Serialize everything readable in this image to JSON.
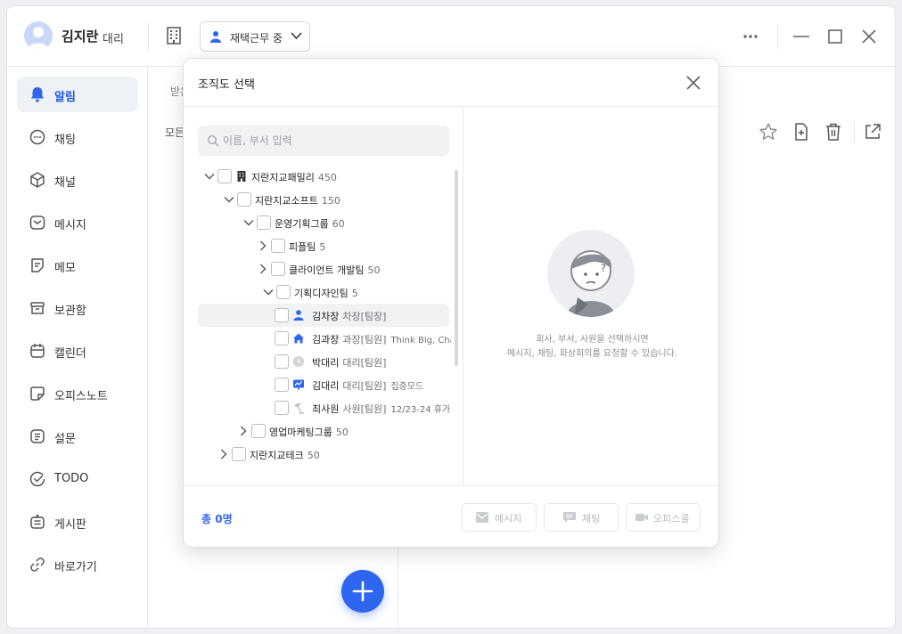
{
  "user": {
    "name": "김지란",
    "rank": "대리"
  },
  "status": {
    "label": "재택근무 중"
  },
  "sidebar": {
    "items": [
      {
        "label": "알림",
        "icon": "bell-icon",
        "active": true
      },
      {
        "label": "채팅",
        "icon": "chat-bubble-icon"
      },
      {
        "label": "채널",
        "icon": "cube-icon"
      },
      {
        "label": "메시지",
        "icon": "envelope-icon"
      },
      {
        "label": "메모",
        "icon": "note-icon"
      },
      {
        "label": "보관함",
        "icon": "archive-box-icon"
      },
      {
        "label": "캘린더",
        "icon": "calendar-icon"
      },
      {
        "label": "오피스노트",
        "icon": "sticky-note-icon"
      },
      {
        "label": "설문",
        "icon": "survey-list-icon"
      },
      {
        "label": "TODO",
        "icon": "check-circle-icon"
      },
      {
        "label": "게시판",
        "icon": "board-icon"
      },
      {
        "label": "바로가기",
        "icon": "link-icon"
      }
    ]
  },
  "midpane": {
    "tab_label": "받은",
    "filter_label": "모든"
  },
  "modal": {
    "title": "조직도 선택",
    "search_placeholder": "이름, 부서 입력",
    "tree": [
      {
        "name": "지란지교패밀리",
        "meta": "450",
        "icon": "building-icon"
      },
      {
        "name": "지란지교소프트",
        "meta": "150"
      },
      {
        "name": "운영기획그룹",
        "meta": "60"
      },
      {
        "name": "피플팀",
        "meta": "5"
      },
      {
        "name": "클라이언트 개발팀",
        "meta": "50"
      },
      {
        "name": "기획디자인팀",
        "meta": "5"
      },
      {
        "name": "김차장",
        "meta": "차장[팀장]",
        "icon": "person-icon"
      },
      {
        "name": "김과장",
        "meta": "과장[팀원]",
        "note": "Think Big, Cha",
        "icon": "home-icon"
      },
      {
        "name": "박대리",
        "meta": "대리[팀원]",
        "icon": "clock-icon"
      },
      {
        "name": "김대리",
        "meta": "대리[팀원]",
        "note": "집중모드",
        "icon": "presentation-icon"
      },
      {
        "name": "최사원",
        "meta": "사원[팀원]",
        "note": "12/23-24 휴가",
        "icon": "vacation-icon"
      },
      {
        "name": "영업마케팅그룹",
        "meta": "50"
      },
      {
        "name": "지란지교테크",
        "meta": "50"
      }
    ],
    "hint_line1": "회사, 부서, 사원을 선택하시면",
    "hint_line2": "메시지, 채팅, 화상회의를 요청할 수 있습니다.",
    "total": "총 0명",
    "buttons": {
      "message": "메시지",
      "chat": "채팅",
      "officecall": "오피스콜"
    }
  },
  "colors": {
    "accent": "#2f66f0",
    "active_nav": "#1f57e6",
    "hover_bg": "#f1f2f4"
  }
}
